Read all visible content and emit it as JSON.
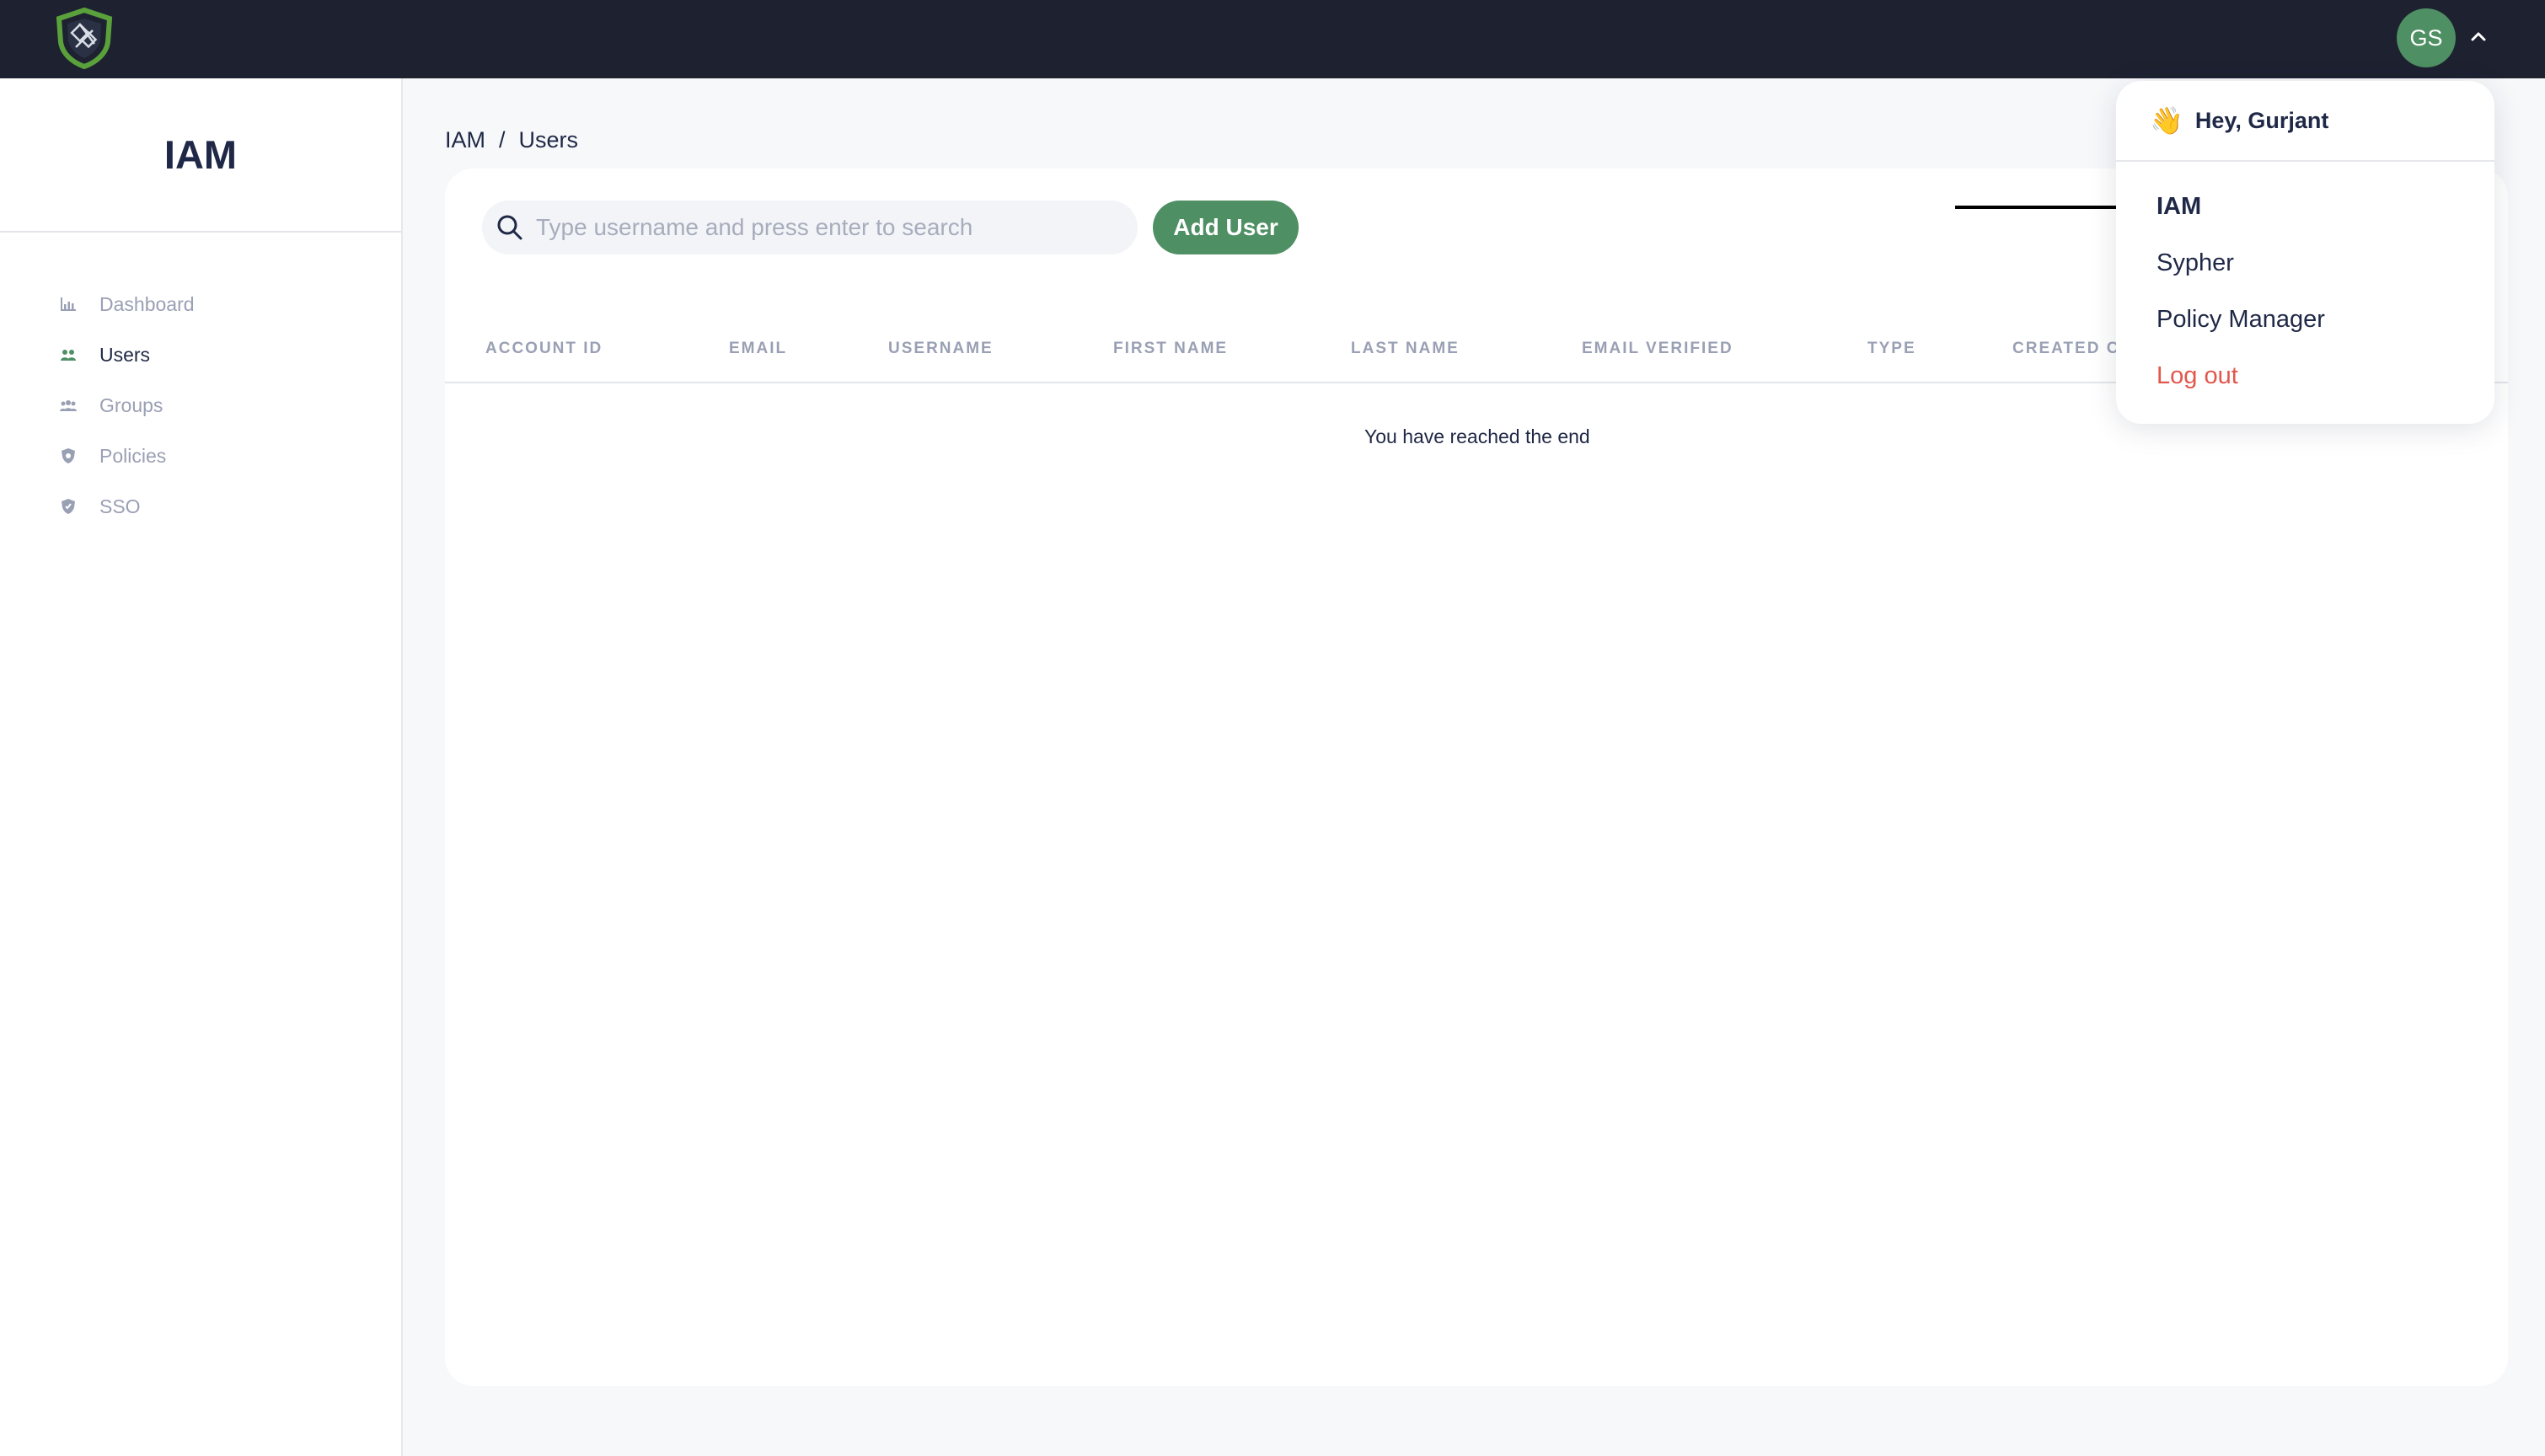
{
  "header": {
    "logo_icon": "shield-logo-icon",
    "avatar_initials": "GS",
    "menu_toggle_icon": "chevron-up-icon"
  },
  "sidebar": {
    "title": "IAM",
    "items": [
      {
        "label": "Dashboard",
        "icon": "chart-icon",
        "active": false
      },
      {
        "label": "Users",
        "icon": "users-icon",
        "active": true
      },
      {
        "label": "Groups",
        "icon": "groups-icon",
        "active": false
      },
      {
        "label": "Policies",
        "icon": "policy-shield-icon",
        "active": false
      },
      {
        "label": "SSO",
        "icon": "sso-shield-icon",
        "active": false
      }
    ]
  },
  "breadcrumb": {
    "root": "IAM",
    "separator": "/",
    "current": "Users"
  },
  "toolbar": {
    "search_placeholder": "Type username and press enter to search",
    "add_user_label": "Add User"
  },
  "table": {
    "columns": [
      "ACCOUNT ID",
      "EMAIL",
      "USERNAME",
      "FIRST NAME",
      "LAST NAME",
      "EMAIL VERIFIED",
      "TYPE",
      "CREATED C"
    ],
    "rows": [],
    "end_message": "You have reached the end"
  },
  "user_menu": {
    "greeting_icon": "👋",
    "greeting": "Hey, Gurjant",
    "items": [
      "IAM",
      "Sypher",
      "Policy Manager"
    ],
    "logout_label": "Log out"
  },
  "colors": {
    "topbar": "#1d2130",
    "accent_green": "#4e8f63",
    "text_dark": "#1f2846",
    "text_muted": "#9aa0b4",
    "logout_red": "#e2574c"
  }
}
